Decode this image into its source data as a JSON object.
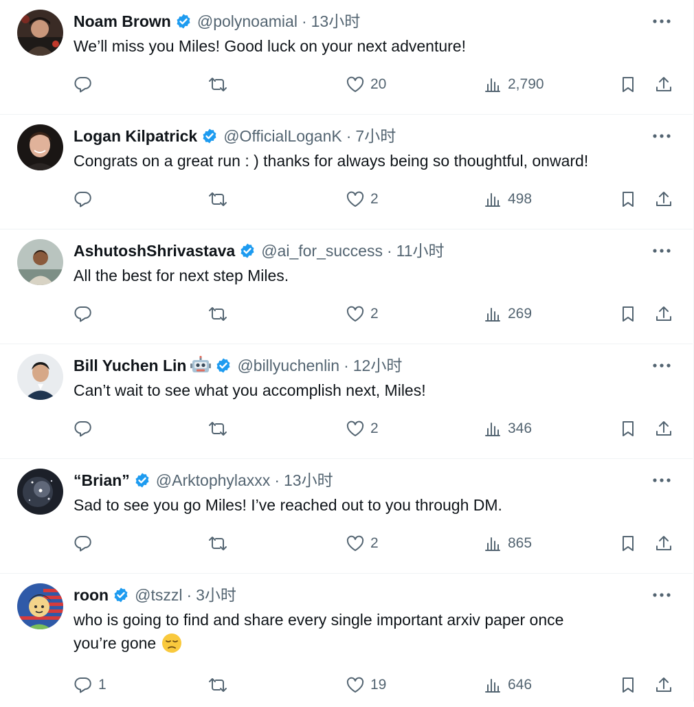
{
  "tweets": [
    {
      "name": "Noam Brown",
      "handle": "@polynoamial",
      "time": "13小时",
      "text": "We’ll miss you Miles! Good luck on your next adventure!",
      "replies": "",
      "likes": "20",
      "views": "2,790",
      "avatar_color": "#6b4b3a"
    },
    {
      "name": "Logan Kilpatrick",
      "handle": "@OfficialLoganK",
      "time": "7小时",
      "text": "Congrats on a great run : ) thanks for always being so thoughtful, onward!",
      "replies": "",
      "likes": "2",
      "views": "498",
      "avatar_color": "#2b2421"
    },
    {
      "name": "AshutoshShrivastava",
      "handle": "@ai_for_success",
      "time": "11小时",
      "text": "All the best for next step Miles.",
      "replies": "",
      "likes": "2",
      "views": "269",
      "avatar_color": "#9aa7a0"
    },
    {
      "name": "Bill Yuchen Lin",
      "handle": "@billyuchenlin",
      "time": "12小时",
      "text": "Can’t wait to see what you accomplish next, Miles!",
      "replies": "",
      "likes": "2",
      "views": "346",
      "avatar_color": "#3b4a5a",
      "name_emoji": "robot-emoji"
    },
    {
      "name": "“Brian”",
      "handle": "@Arktophylaxxx",
      "time": "13小时",
      "text": "Sad to see you go Miles! I’ve reached out to you through DM.",
      "replies": "",
      "likes": "2",
      "views": "865",
      "avatar_color": "#2a2f3a"
    },
    {
      "name": "roon",
      "handle": "@tszzl",
      "time": "3小时",
      "text_line1": "who is going to find and share every single important arxiv paper once",
      "text_line2": "you’re gone",
      "text_emoji": "pensive-face-emoji",
      "replies": "1",
      "likes": "19",
      "views": "646",
      "avatar_color": "#2f5aa8"
    }
  ],
  "colors": {
    "text": "#0f1419",
    "secondary": "#536471",
    "verified": "#1d9bf0",
    "divider": "#eff3f4"
  },
  "icons": [
    "reply-icon",
    "retweet-icon",
    "like-icon",
    "views-icon",
    "bookmark-icon",
    "share-icon",
    "more-icon",
    "verified-badge-icon"
  ]
}
